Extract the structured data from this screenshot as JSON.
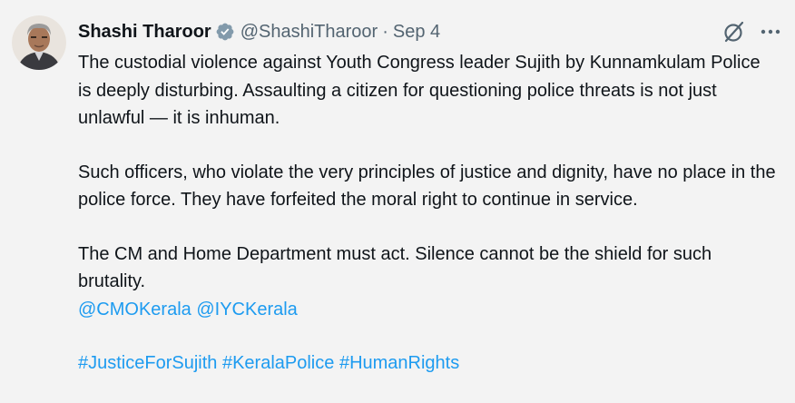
{
  "author": {
    "name": "Shashi Tharoor",
    "handle": "@ShashiTharoor",
    "separator": "·",
    "date": "Sep 4"
  },
  "tweet": {
    "paragraph1": "The custodial violence against Youth Congress leader Sujith by Kunnamkulam Police is deeply disturbing. Assaulting a citizen for questioning police threats is not just unlawful — it is inhuman.",
    "paragraph2": "Such officers, who violate the very principles of justice and dignity, have no place in the police force. They have forfeited the moral right to continue in service.",
    "paragraph3": "The CM and Home Department must act. Silence cannot be the shield for such brutality.",
    "mentions": [
      "@CMOKerala",
      "@IYCKerala"
    ],
    "hashtags": [
      "#JusticeForSujith",
      "#KeralaPolice",
      "#HumanRights"
    ]
  },
  "icons": {
    "verified": "verified-badge-icon",
    "grok": "grok-icon",
    "more": "more-options-icon"
  },
  "colors": {
    "background": "#f3f3f3",
    "text": "#0f1419",
    "secondary": "#536471",
    "link": "#1d9bf0"
  }
}
